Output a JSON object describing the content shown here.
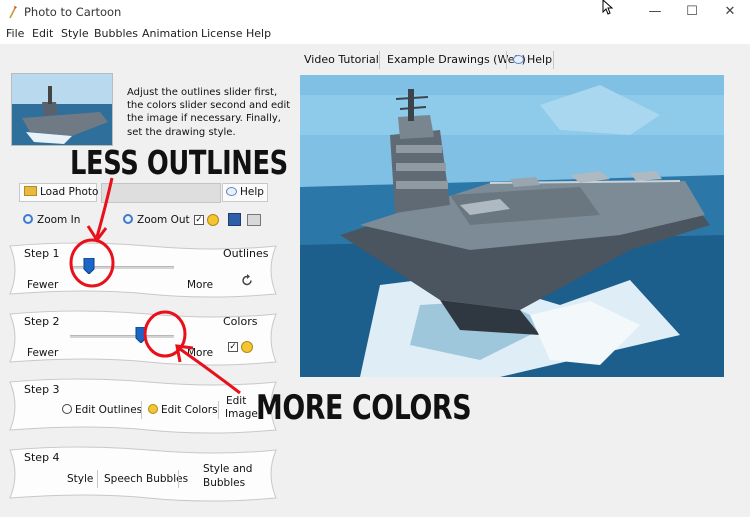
{
  "window": {
    "title": "Photo to Cartoon",
    "minimize": "—",
    "maximize": "☐",
    "close": "✕"
  },
  "menu": [
    "File",
    "Edit",
    "Style",
    "Bubbles",
    "Animation",
    "License",
    "Help"
  ],
  "instructions": "Adjust the outlines slider first, the colors slider second and edit the image if necessary. Finally, set the drawing style.",
  "toolbar": {
    "load_photo": "Load Photo",
    "help": "Help",
    "zoom_in": "Zoom In",
    "zoom_out": "Zoom Out"
  },
  "step1": {
    "label": "Step 1",
    "title": "Outlines",
    "fewer": "Fewer",
    "more": "More",
    "slider_value": 0.18
  },
  "step2": {
    "label": "Step 2",
    "title": "Colors",
    "fewer": "Fewer",
    "more": "More",
    "slider_value": 0.68
  },
  "step3": {
    "label": "Step 3",
    "edit_outlines": "Edit Outlines",
    "edit_colors": "Edit Colors",
    "edit_image_1": "Edit",
    "edit_image_2": "Image"
  },
  "step4": {
    "label": "Step 4",
    "style": "Style",
    "speech_bubbles": "Speech Bubbles",
    "style_bubbles_1": "Style and",
    "style_bubbles_2": "Bubbles"
  },
  "tabs": {
    "video": "Video Tutorial",
    "examples": "Example Drawings (Web)",
    "help": "Help"
  },
  "annotations": {
    "less_outlines": "LESS OUTLINES",
    "more_colors": "MORE COLORS"
  },
  "colors": {
    "annotation_red": "#e8101a",
    "slider_blue": "#1a66c8",
    "sky": "#7fc0e4",
    "ocean": "#1f6a98"
  }
}
